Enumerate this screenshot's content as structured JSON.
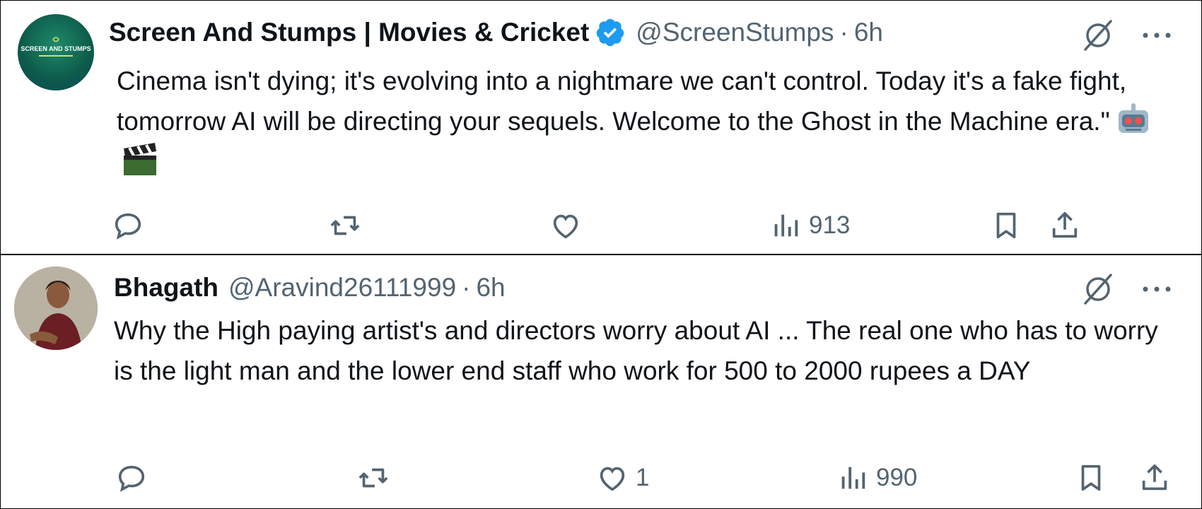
{
  "tweets": [
    {
      "author_name": "Screen And Stumps | Movies & Cricket",
      "verified": true,
      "handle": "@ScreenStumps",
      "separator": "·",
      "time": "6h",
      "avatar_text": "SCREEN AND STUMPS",
      "text": "Cinema isn't dying; it's evolving into a nightmare we can't control. Today it's a fake fight, tomorrow AI will be directing your sequels. Welcome to the Ghost in the Machine era.\"",
      "emojis": [
        "robot-emoji",
        "clapper-board-emoji"
      ],
      "likes": "",
      "views": "913"
    },
    {
      "author_name": "Bhagath",
      "verified": false,
      "handle": "@Aravind26111999",
      "separator": "·",
      "time": "6h",
      "text": "Why the High paying artist's and directors worry about AI ... The real one who has to worry is the light man and the lower end staff who work for 500 to 2000 rupees a DAY",
      "likes": "1",
      "views": "990"
    }
  ],
  "icons": {
    "reply": "reply-icon",
    "retweet": "retweet-icon",
    "like": "heart-icon",
    "views": "analytics-icon",
    "bookmark": "bookmark-icon",
    "share": "share-icon",
    "grok": "grok-icon",
    "more": "more-icon",
    "verified": "verified-badge-icon"
  },
  "colors": {
    "text": "#0f1419",
    "secondary": "#536471",
    "verified": "#1d9bf0"
  }
}
